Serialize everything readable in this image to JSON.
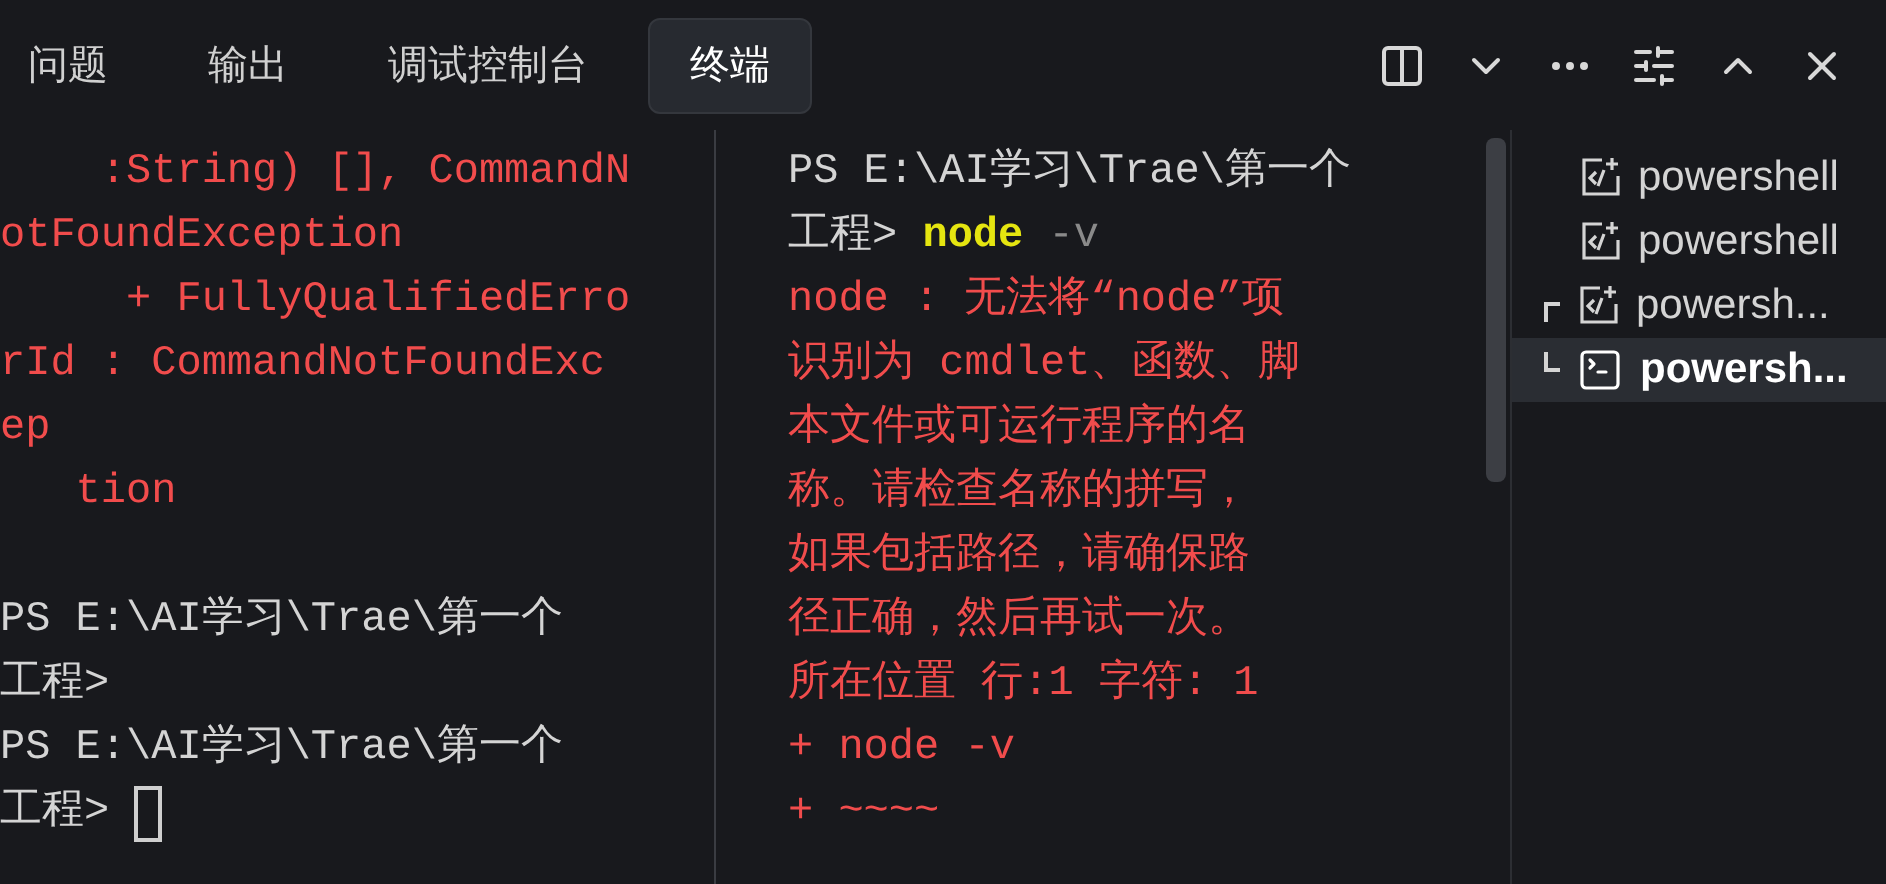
{
  "tabs": [
    {
      "label": "问题",
      "selected": false
    },
    {
      "label": "输出",
      "selected": false
    },
    {
      "label": "调试控制台",
      "selected": false
    },
    {
      "label": "终端",
      "selected": true
    }
  ],
  "terminal_panes": [
    {
      "blocks": [
        {
          "lines": [
            {
              "spans": [
                {
                  "text": "    :String) [], CommandN",
                  "kind": "error"
                }
              ]
            },
            {
              "spans": [
                {
                  "text": "otFoundException",
                  "kind": "error"
                }
              ]
            },
            {
              "spans": [
                {
                  "text": "     + FullyQualifiedErro",
                  "kind": "error"
                }
              ]
            },
            {
              "spans": [
                {
                  "text": "rId : CommandNotFoundExc",
                  "kind": "error"
                }
              ]
            },
            {
              "spans": [
                {
                  "text": "ep",
                  "kind": "error"
                }
              ]
            },
            {
              "spans": [
                {
                  "text": "   tion",
                  "kind": "error"
                }
              ]
            }
          ]
        },
        {
          "lines": [
            {
              "spans": [
                {
                  "text": "PS E:\\AI学习\\Trae\\第一个",
                  "kind": "plain"
                }
              ]
            },
            {
              "spans": [
                {
                  "text": "工程>",
                  "kind": "plain"
                }
              ]
            },
            {
              "spans": [
                {
                  "text": "PS E:\\AI学习\\Trae\\第一个",
                  "kind": "plain"
                }
              ]
            },
            {
              "spans": [
                {
                  "text": "工程> ",
                  "kind": "plain"
                }
              ],
              "cursor": true
            }
          ]
        }
      ]
    },
    {
      "blocks": [
        {
          "lines": [
            {
              "spans": [
                {
                  "text": "PS E:\\AI学习\\Trae\\第一个",
                  "kind": "plain"
                }
              ]
            },
            {
              "spans": [
                {
                  "text": "工程> ",
                  "kind": "plain"
                },
                {
                  "text": "node",
                  "kind": "command"
                },
                {
                  "text": " -v",
                  "kind": "arg"
                }
              ]
            },
            {
              "spans": [
                {
                  "text": "node : 无法将“node”项",
                  "kind": "error"
                }
              ]
            },
            {
              "spans": [
                {
                  "text": "识别为 cmdlet、函数、脚",
                  "kind": "error"
                }
              ]
            },
            {
              "spans": [
                {
                  "text": "本文件或可运行程序的名",
                  "kind": "error"
                }
              ]
            },
            {
              "spans": [
                {
                  "text": "称。请检查名称的拼写，",
                  "kind": "error"
                }
              ]
            },
            {
              "spans": [
                {
                  "text": "如果包括路径，请确保路",
                  "kind": "error"
                }
              ]
            },
            {
              "spans": [
                {
                  "text": "径正确，然后再试一次。",
                  "kind": "error"
                }
              ]
            },
            {
              "spans": [
                {
                  "text": "所在位置 行:1 字符: 1",
                  "kind": "error"
                }
              ]
            },
            {
              "spans": [
                {
                  "text": "+ node -v",
                  "kind": "error"
                }
              ]
            },
            {
              "spans": [
                {
                  "text": "+ ~~~~",
                  "kind": "error"
                }
              ]
            }
          ]
        }
      ]
    }
  ],
  "terminal_list": [
    {
      "label": "powershell",
      "kind": "task",
      "selected": false
    },
    {
      "label": "powershell",
      "kind": "task",
      "selected": false
    },
    {
      "kind": "split",
      "children": [
        {
          "label": "powersh...",
          "kind": "task",
          "selected": false
        },
        {
          "label": "powersh...",
          "kind": "shell",
          "selected": true
        }
      ]
    }
  ]
}
